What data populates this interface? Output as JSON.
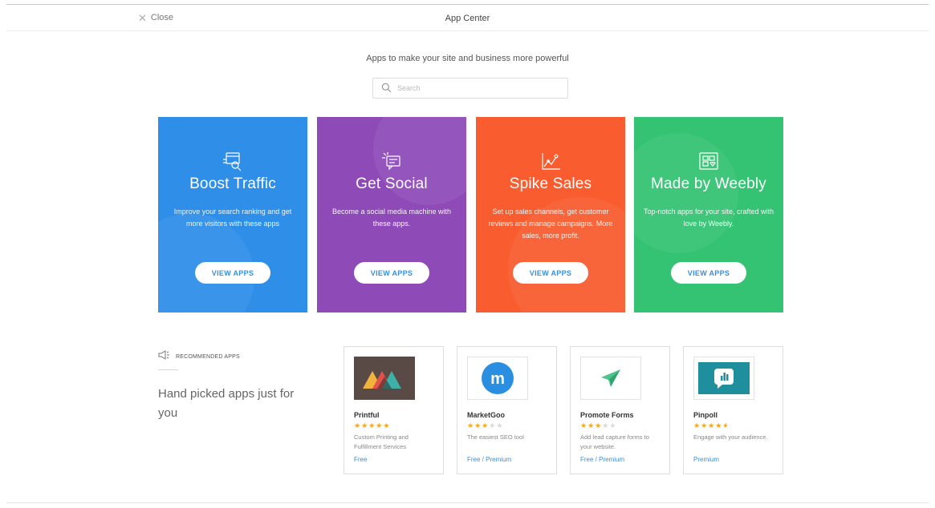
{
  "header": {
    "close_label": "Close",
    "title": "App Center"
  },
  "intro": {
    "subtitle": "Apps to make your site and business more powerful",
    "search_placeholder": "Search"
  },
  "categories": [
    {
      "title": "Boost Traffic",
      "description": "Improve your search ranking and get more visitors with these apps",
      "button": "VIEW APPS",
      "color": "#2e8ee8",
      "icon": "seo-search-icon"
    },
    {
      "title": "Get Social",
      "description": "Become a social media machine with these apps.",
      "button": "VIEW APPS",
      "color": "#8e4bb8",
      "icon": "chat-bubble-icon"
    },
    {
      "title": "Spike Sales",
      "description": "Set up sales channels, get customer reviews and manage campaigns. More sales, more profit.",
      "button": "VIEW APPS",
      "color": "#f95c2e",
      "icon": "sales-chart-icon"
    },
    {
      "title": "Made by Weebly",
      "description": "Top-notch apps for your site, crafted with love by Weebly.",
      "button": "VIEW APPS",
      "color": "#34c373",
      "icon": "weebly-apps-icon"
    }
  ],
  "recommended": {
    "label": "RECOMMENDED APPS",
    "tagline": "Hand picked apps just for you",
    "icon": "megaphone-icon"
  },
  "apps": [
    {
      "name": "Printful",
      "rating": 5,
      "description": "Custom Printing and Fulfillment Services",
      "price": "Free",
      "icon": "printful-logo"
    },
    {
      "name": "MarketGoo",
      "rating": 3,
      "description": "The easiest SEO tool",
      "price": "Free / Premium",
      "icon": "marketgoo-logo"
    },
    {
      "name": "Promote Forms",
      "rating": 3,
      "description": "Add lead capture forms to your website.",
      "price": "Free / Premium",
      "icon": "paper-plane-logo"
    },
    {
      "name": "Pinpoll",
      "rating": 4.5,
      "description": "Engage with your audience.",
      "price": "Premium",
      "icon": "pinpoll-logo"
    }
  ],
  "colors": {
    "accent": "#3a8fde",
    "star": "#f5a623",
    "marketgoo": "#2a8fe0",
    "promote_forms": "#4cc48a",
    "pinpoll": "#1f8f9e",
    "printful_bg": "#5a4a45"
  }
}
